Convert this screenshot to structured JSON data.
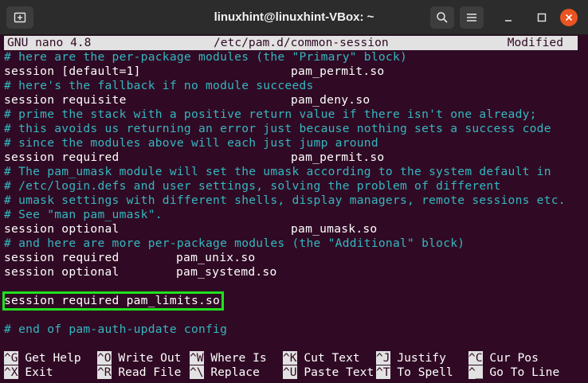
{
  "window": {
    "title": "linuxhint@linuxhint-VBox: ~"
  },
  "nano": {
    "version": "GNU nano 4.8",
    "file": "/etc/pam.d/common-session",
    "status": "Modified"
  },
  "lines": [
    {
      "type": "comment",
      "text": "# here are the per-package modules (the \"Primary\" block)"
    },
    {
      "type": "code",
      "col1": "session [default=1]",
      "col2": "pam_permit.so",
      "col2pos": "wide"
    },
    {
      "type": "comment",
      "text": "# here's the fallback if no module succeeds"
    },
    {
      "type": "code",
      "col1": "session requisite",
      "col2": "pam_deny.so",
      "col2pos": "wide"
    },
    {
      "type": "comment",
      "text": "# prime the stack with a positive return value if there isn't one already;"
    },
    {
      "type": "comment",
      "text": "# this avoids us returning an error just because nothing sets a success code"
    },
    {
      "type": "comment",
      "text": "# since the modules above will each just jump around"
    },
    {
      "type": "code",
      "col1": "session required",
      "col2": "pam_permit.so",
      "col2pos": "wide"
    },
    {
      "type": "comment",
      "text": "# The pam_umask module will set the umask according to the system default in"
    },
    {
      "type": "comment",
      "text": "# /etc/login.defs and user settings, solving the problem of different"
    },
    {
      "type": "comment",
      "text": "# umask settings with different shells, display managers, remote sessions etc."
    },
    {
      "type": "comment",
      "text": "# See \"man pam_umask\"."
    },
    {
      "type": "code",
      "col1": "session optional",
      "col2": "pam_umask.so",
      "col2pos": "wide"
    },
    {
      "type": "comment",
      "text": "# and here are more per-package modules (the \"Additional\" block)"
    },
    {
      "type": "code",
      "col1": "session required",
      "col2": "pam_unix.so",
      "col2pos": "narrow"
    },
    {
      "type": "code",
      "col1": "session optional",
      "col2": "pam_systemd.so",
      "col2pos": "narrow"
    },
    {
      "type": "blank",
      "text": ""
    },
    {
      "type": "highlight",
      "text": "session required pam_limits.so"
    },
    {
      "type": "blank",
      "text": ""
    },
    {
      "type": "comment",
      "text": "# end of pam-auth-update config"
    }
  ],
  "shortcuts": [
    {
      "key": "^G",
      "label": "Get Help"
    },
    {
      "key": "^X",
      "label": "Exit"
    },
    {
      "key": "^O",
      "label": "Write Out"
    },
    {
      "key": "^R",
      "label": "Read File"
    },
    {
      "key": "^W",
      "label": "Where Is"
    },
    {
      "key": "^\\",
      "label": "Replace"
    },
    {
      "key": "^K",
      "label": "Cut Text"
    },
    {
      "key": "^U",
      "label": "Paste Text"
    },
    {
      "key": "^J",
      "label": "Justify"
    },
    {
      "key": "^T",
      "label": "To Spell"
    },
    {
      "key": "^C",
      "label": "Cur Pos"
    },
    {
      "key": "^_",
      "label": "Go To Line"
    }
  ],
  "colors": {
    "terminal_bg": "#300a24",
    "comment": "#34b7c0",
    "highlight_border": "#22e01f",
    "close_button": "#e95420"
  },
  "icons": {
    "new_tab": "new-tab-icon",
    "search": "search-icon",
    "menu": "hamburger-menu-icon",
    "minimize": "minimize-icon",
    "maximize": "maximize-icon",
    "close": "close-icon"
  }
}
